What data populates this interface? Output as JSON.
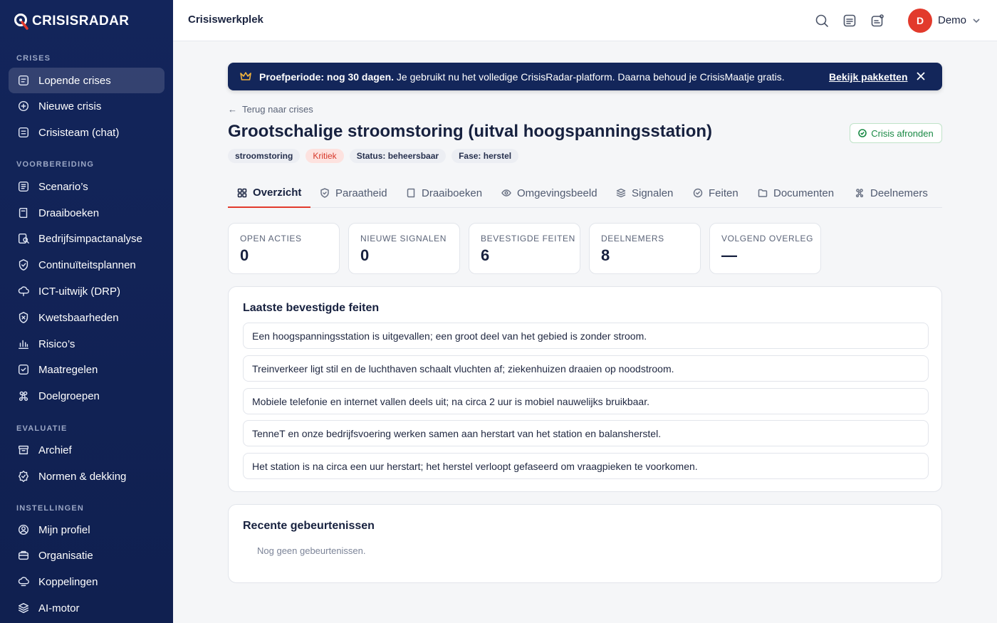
{
  "app": {
    "logo_text": "CRISISRADAR"
  },
  "sidebar": {
    "sections": [
      {
        "label": "CRISES",
        "items": [
          {
            "label": "Lopende crises",
            "icon": "list-icon",
            "active": true
          },
          {
            "label": "Nieuwe crisis",
            "icon": "plus-circle-icon"
          },
          {
            "label": "Crisisteam (chat)",
            "icon": "chat-icon"
          }
        ]
      },
      {
        "label": "VOORBEREIDING",
        "items": [
          {
            "label": "Scenario’s",
            "icon": "document-icon"
          },
          {
            "label": "Draaiboeken",
            "icon": "book-icon"
          },
          {
            "label": "Bedrijfsimpactanalyse",
            "icon": "analysis-icon"
          },
          {
            "label": "Continuïteitsplannen",
            "icon": "shield-check-icon"
          },
          {
            "label": "ICT-uitwijk (DRP)",
            "icon": "cloud-icon"
          },
          {
            "label": "Kwetsbaarheden",
            "icon": "shield-x-icon"
          },
          {
            "label": "Risico’s",
            "icon": "bar-chart-icon"
          },
          {
            "label": "Maatregelen",
            "icon": "check-square-icon"
          },
          {
            "label": "Doelgroepen",
            "icon": "people-icon"
          }
        ]
      },
      {
        "label": "EVALUATIE",
        "items": [
          {
            "label": "Archief",
            "icon": "archive-icon"
          },
          {
            "label": "Normen & dekking",
            "icon": "badge-check-icon"
          }
        ]
      },
      {
        "label": "INSTELLINGEN",
        "items": [
          {
            "label": "Mijn profiel",
            "icon": "user-circle-icon"
          },
          {
            "label": "Organisatie",
            "icon": "briefcase-icon"
          },
          {
            "label": "Koppelingen",
            "icon": "cloud-link-icon"
          },
          {
            "label": "AI-motor",
            "icon": "layers-icon"
          }
        ]
      }
    ]
  },
  "topbar": {
    "title": "Crisiswerkplek",
    "user_initial": "D",
    "user_name": "Demo"
  },
  "banner": {
    "bold": "Proefperiode: nog 30 dagen.",
    "text": " Je gebruikt nu het volledige CrisisRadar-platform. Daarna behoud je CrisisMaatje gratis.",
    "link": "Bekijk pakketten"
  },
  "crisis": {
    "back_label": "Terug naar crises",
    "title": "Grootschalige stroomstoring (uitval hoogspanningsstation)",
    "close_label": "Crisis afronden",
    "tags": [
      {
        "label": "stroomstoring",
        "kind": "type"
      },
      {
        "label": "Kritiek",
        "kind": "critical"
      },
      {
        "label": "Status: beheersbaar",
        "kind": "status"
      },
      {
        "label": "Fase: herstel",
        "kind": "phase"
      }
    ]
  },
  "tabs": [
    {
      "label": "Overzicht",
      "icon": "grid-icon",
      "active": true
    },
    {
      "label": "Paraatheid",
      "icon": "shield-check-icon"
    },
    {
      "label": "Draaiboeken",
      "icon": "book-icon"
    },
    {
      "label": "Omgevingsbeeld",
      "icon": "eye-icon"
    },
    {
      "label": "Signalen",
      "icon": "layers-icon"
    },
    {
      "label": "Feiten",
      "icon": "check-circle-icon"
    },
    {
      "label": "Documenten",
      "icon": "folder-icon"
    },
    {
      "label": "Deelnemers",
      "icon": "people-icon"
    }
  ],
  "stats": [
    {
      "label": "OPEN ACTIES",
      "value": "0"
    },
    {
      "label": "NIEUWE SIGNALEN",
      "value": "0"
    },
    {
      "label": "BEVESTIGDE FEITEN",
      "value": "6"
    },
    {
      "label": "DEELNEMERS",
      "value": "8"
    },
    {
      "label": "VOLGEND OVERLEG",
      "value": "—"
    }
  ],
  "facts": {
    "title": "Laatste bevestigde feiten",
    "items": [
      "Een hoogspanningsstation is uitgevallen; een groot deel van het gebied is zonder stroom.",
      "Treinverkeer ligt stil en de luchthaven schaalt vluchten af; ziekenhuizen draaien op noodstroom.",
      "Mobiele telefonie en internet vallen deels uit; na circa 2 uur is mobiel nauwelijks bruikbaar.",
      "TenneT en onze bedrijfsvoering werken samen aan herstart van het station en balansherstel.",
      "Het station is na circa een uur herstart; het herstel verloopt gefaseerd om vraagpieken te voorkomen."
    ]
  },
  "events": {
    "title": "Recente gebeurtenissen",
    "empty": "Nog geen gebeurtenissen."
  },
  "colors": {
    "sidebar": "#13265a",
    "accent": "#e23a2c",
    "success": "#1a8a45",
    "banner_icon": "#f3b43c"
  }
}
